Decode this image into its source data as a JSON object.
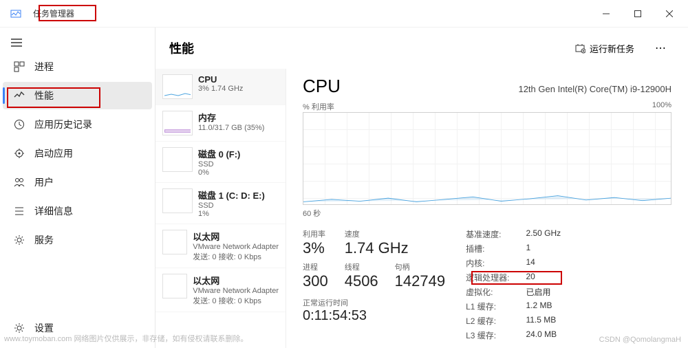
{
  "window": {
    "title": "任务管理器",
    "controls": {
      "min": "minimize",
      "max": "maximize",
      "close": "close"
    }
  },
  "sidebar": {
    "items": [
      {
        "icon": "processes-icon",
        "label": "进程"
      },
      {
        "icon": "performance-icon",
        "label": "性能"
      },
      {
        "icon": "app-history-icon",
        "label": "应用历史记录"
      },
      {
        "icon": "startup-icon",
        "label": "启动应用"
      },
      {
        "icon": "users-icon",
        "label": "用户"
      },
      {
        "icon": "details-icon",
        "label": "详细信息"
      },
      {
        "icon": "services-icon",
        "label": "服务"
      }
    ],
    "settings": "设置"
  },
  "header": {
    "title": "性能",
    "runTask": "运行新任务"
  },
  "perfList": [
    {
      "title": "CPU",
      "sub": "3%  1.74 GHz",
      "color": "#4aa3df"
    },
    {
      "title": "内存",
      "sub": "11.0/31.7 GB (35%)",
      "color": "#a05cc7"
    },
    {
      "title": "磁盘 0 (F:)",
      "sub1": "SSD",
      "sub2": "0%",
      "color": "#6aa84f"
    },
    {
      "title": "磁盘 1 (C: D: E:)",
      "sub1": "SSD",
      "sub2": "1%",
      "color": "#6aa84f"
    },
    {
      "title": "以太网",
      "sub1": "VMware Network Adapter",
      "sub2": "发送: 0 接收: 0 Kbps",
      "color": "#b58b4c"
    },
    {
      "title": "以太网",
      "sub1": "VMware Network Adapter",
      "sub2": "发送: 0 接收: 0 Kbps",
      "color": "#b58b4c"
    }
  ],
  "detail": {
    "title": "CPU",
    "model": "12th Gen Intel(R) Core(TM) i9-12900H",
    "utilLabel": "% 利用率",
    "maxPct": "100%",
    "xAxis": "60 秒",
    "big": {
      "util_l": "利用率",
      "util_v": "3%",
      "speed_l": "速度",
      "speed_v": "1.74 GHz",
      "proc_l": "进程",
      "proc_v": "300",
      "thread_l": "线程",
      "thread_v": "4506",
      "handle_l": "句柄",
      "handle_v": "142749"
    },
    "uptime_l": "正常运行时间",
    "uptime_v": "0:11:54:53",
    "small": {
      "base_l": "基准速度:",
      "base_v": "2.50 GHz",
      "sockets_l": "插槽:",
      "sockets_v": "1",
      "cores_l": "内核:",
      "cores_v": "14",
      "logical_l": "逻辑处理器:",
      "logical_v": "20",
      "virt_l": "虚拟化:",
      "virt_v": "已启用",
      "l1_l": "L1 缓存:",
      "l1_v": "1.2 MB",
      "l2_l": "L2 缓存:",
      "l2_v": "11.5 MB",
      "l3_l": "L3 缓存:",
      "l3_v": "24.0 MB"
    }
  },
  "watermark": {
    "left": "www.toymoban.com 网络图片仅供展示，非存储，如有侵权请联系删除。",
    "right": "CSDN @QomolangmaH"
  },
  "chart_data": {
    "type": "line",
    "title": "CPU % 利用率",
    "xlabel": "60 秒",
    "ylabel": "% 利用率",
    "ylim": [
      0,
      100
    ],
    "x": [
      0,
      5,
      10,
      15,
      20,
      25,
      30,
      35,
      40,
      45,
      50,
      55,
      60
    ],
    "series": [
      {
        "name": "CPU 利用率 (%)",
        "values": [
          3,
          5,
          4,
          6,
          3,
          5,
          7,
          4,
          6,
          8,
          5,
          7,
          4
        ]
      }
    ]
  }
}
